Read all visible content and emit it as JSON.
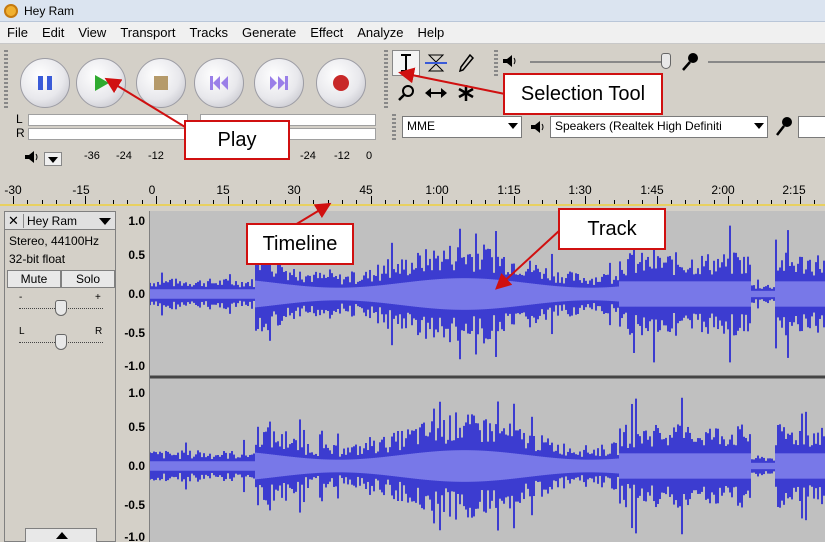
{
  "window": {
    "title": "Hey Ram"
  },
  "menu": [
    "File",
    "Edit",
    "View",
    "Transport",
    "Tracks",
    "Generate",
    "Effect",
    "Analyze",
    "Help"
  ],
  "meter": {
    "channel_left": "L",
    "channel_right": "R",
    "scale_left": [
      "-36",
      "-24",
      "-12"
    ],
    "scale_right": [
      "-24",
      "-12",
      "0"
    ]
  },
  "devices": {
    "host": "MME",
    "output": "Speakers (Realtek High Definiti"
  },
  "timeline": {
    "labels": [
      "-30",
      "-15",
      "0",
      "15",
      "30",
      "45",
      "1:00",
      "1:15",
      "1:30",
      "1:45",
      "2:00",
      "2:15"
    ]
  },
  "track": {
    "name": "Hey Ram",
    "info_line1": "Stereo, 44100Hz",
    "info_line2": "32-bit float",
    "mute_label": "Mute",
    "solo_label": "Solo",
    "gain_minus": "-",
    "gain_plus": "+",
    "pan_left": "L",
    "pan_right": "R",
    "close_glyph": "✕"
  },
  "vertical_scale": [
    "1.0",
    "0.5",
    "0.0",
    "-0.5",
    "-1.0"
  ],
  "callouts": {
    "play": "Play",
    "selection_tool": "Selection Tool",
    "timeline": "Timeline",
    "track": "Track"
  },
  "colors": {
    "waveform": "#3c3cd0",
    "waveform_rms": "#7878e8",
    "callout_border": "#d01010",
    "play_green": "#2faa2f",
    "record_red": "#c82828",
    "pause_blue": "#3a5bd8",
    "skip_purple": "#9a7fe8"
  }
}
